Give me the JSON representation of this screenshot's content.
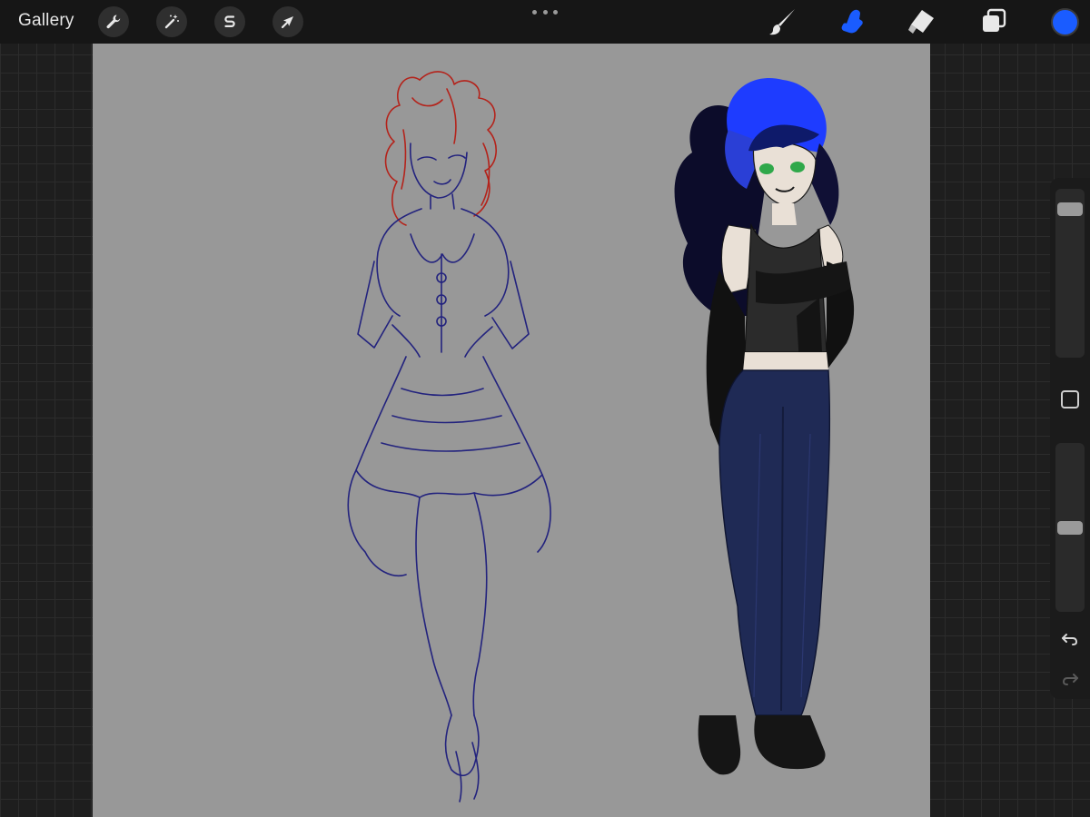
{
  "toolbar": {
    "gallery_label": "Gallery",
    "actions": [
      {
        "name": "actions-button",
        "icon": "wrench-icon"
      },
      {
        "name": "adjustments-button",
        "icon": "magic-wand-icon"
      },
      {
        "name": "selection-button",
        "icon": "selection-s-icon"
      },
      {
        "name": "transform-button",
        "icon": "arrow-cursor-icon"
      }
    ],
    "tools": [
      {
        "name": "brush-tool",
        "icon": "brush-icon",
        "active": false
      },
      {
        "name": "smudge-tool",
        "icon": "smudge-finger-icon",
        "active": true
      },
      {
        "name": "eraser-tool",
        "icon": "eraser-icon",
        "active": false
      },
      {
        "name": "layers-button",
        "icon": "layers-icon",
        "active": false
      }
    ],
    "current_color": "#1a5cff",
    "active_tool_color": "#1a5cff"
  },
  "canvas": {
    "background_color": "#989898",
    "figures": [
      {
        "name": "sketch-figure-victorian-dress",
        "line_colors": [
          "#b4231b",
          "#23237e"
        ]
      },
      {
        "name": "colored-figure-goth-girl",
        "hair_colors": [
          "#0c0c2a",
          "#1e3cff"
        ],
        "pants_color": "#1f2a55"
      }
    ]
  },
  "sidebar": {
    "brush_size_level": 0.93,
    "opacity_level": 0.5,
    "undo_icon": "undo-arrow-icon",
    "redo_icon": "redo-arrow-icon"
  }
}
